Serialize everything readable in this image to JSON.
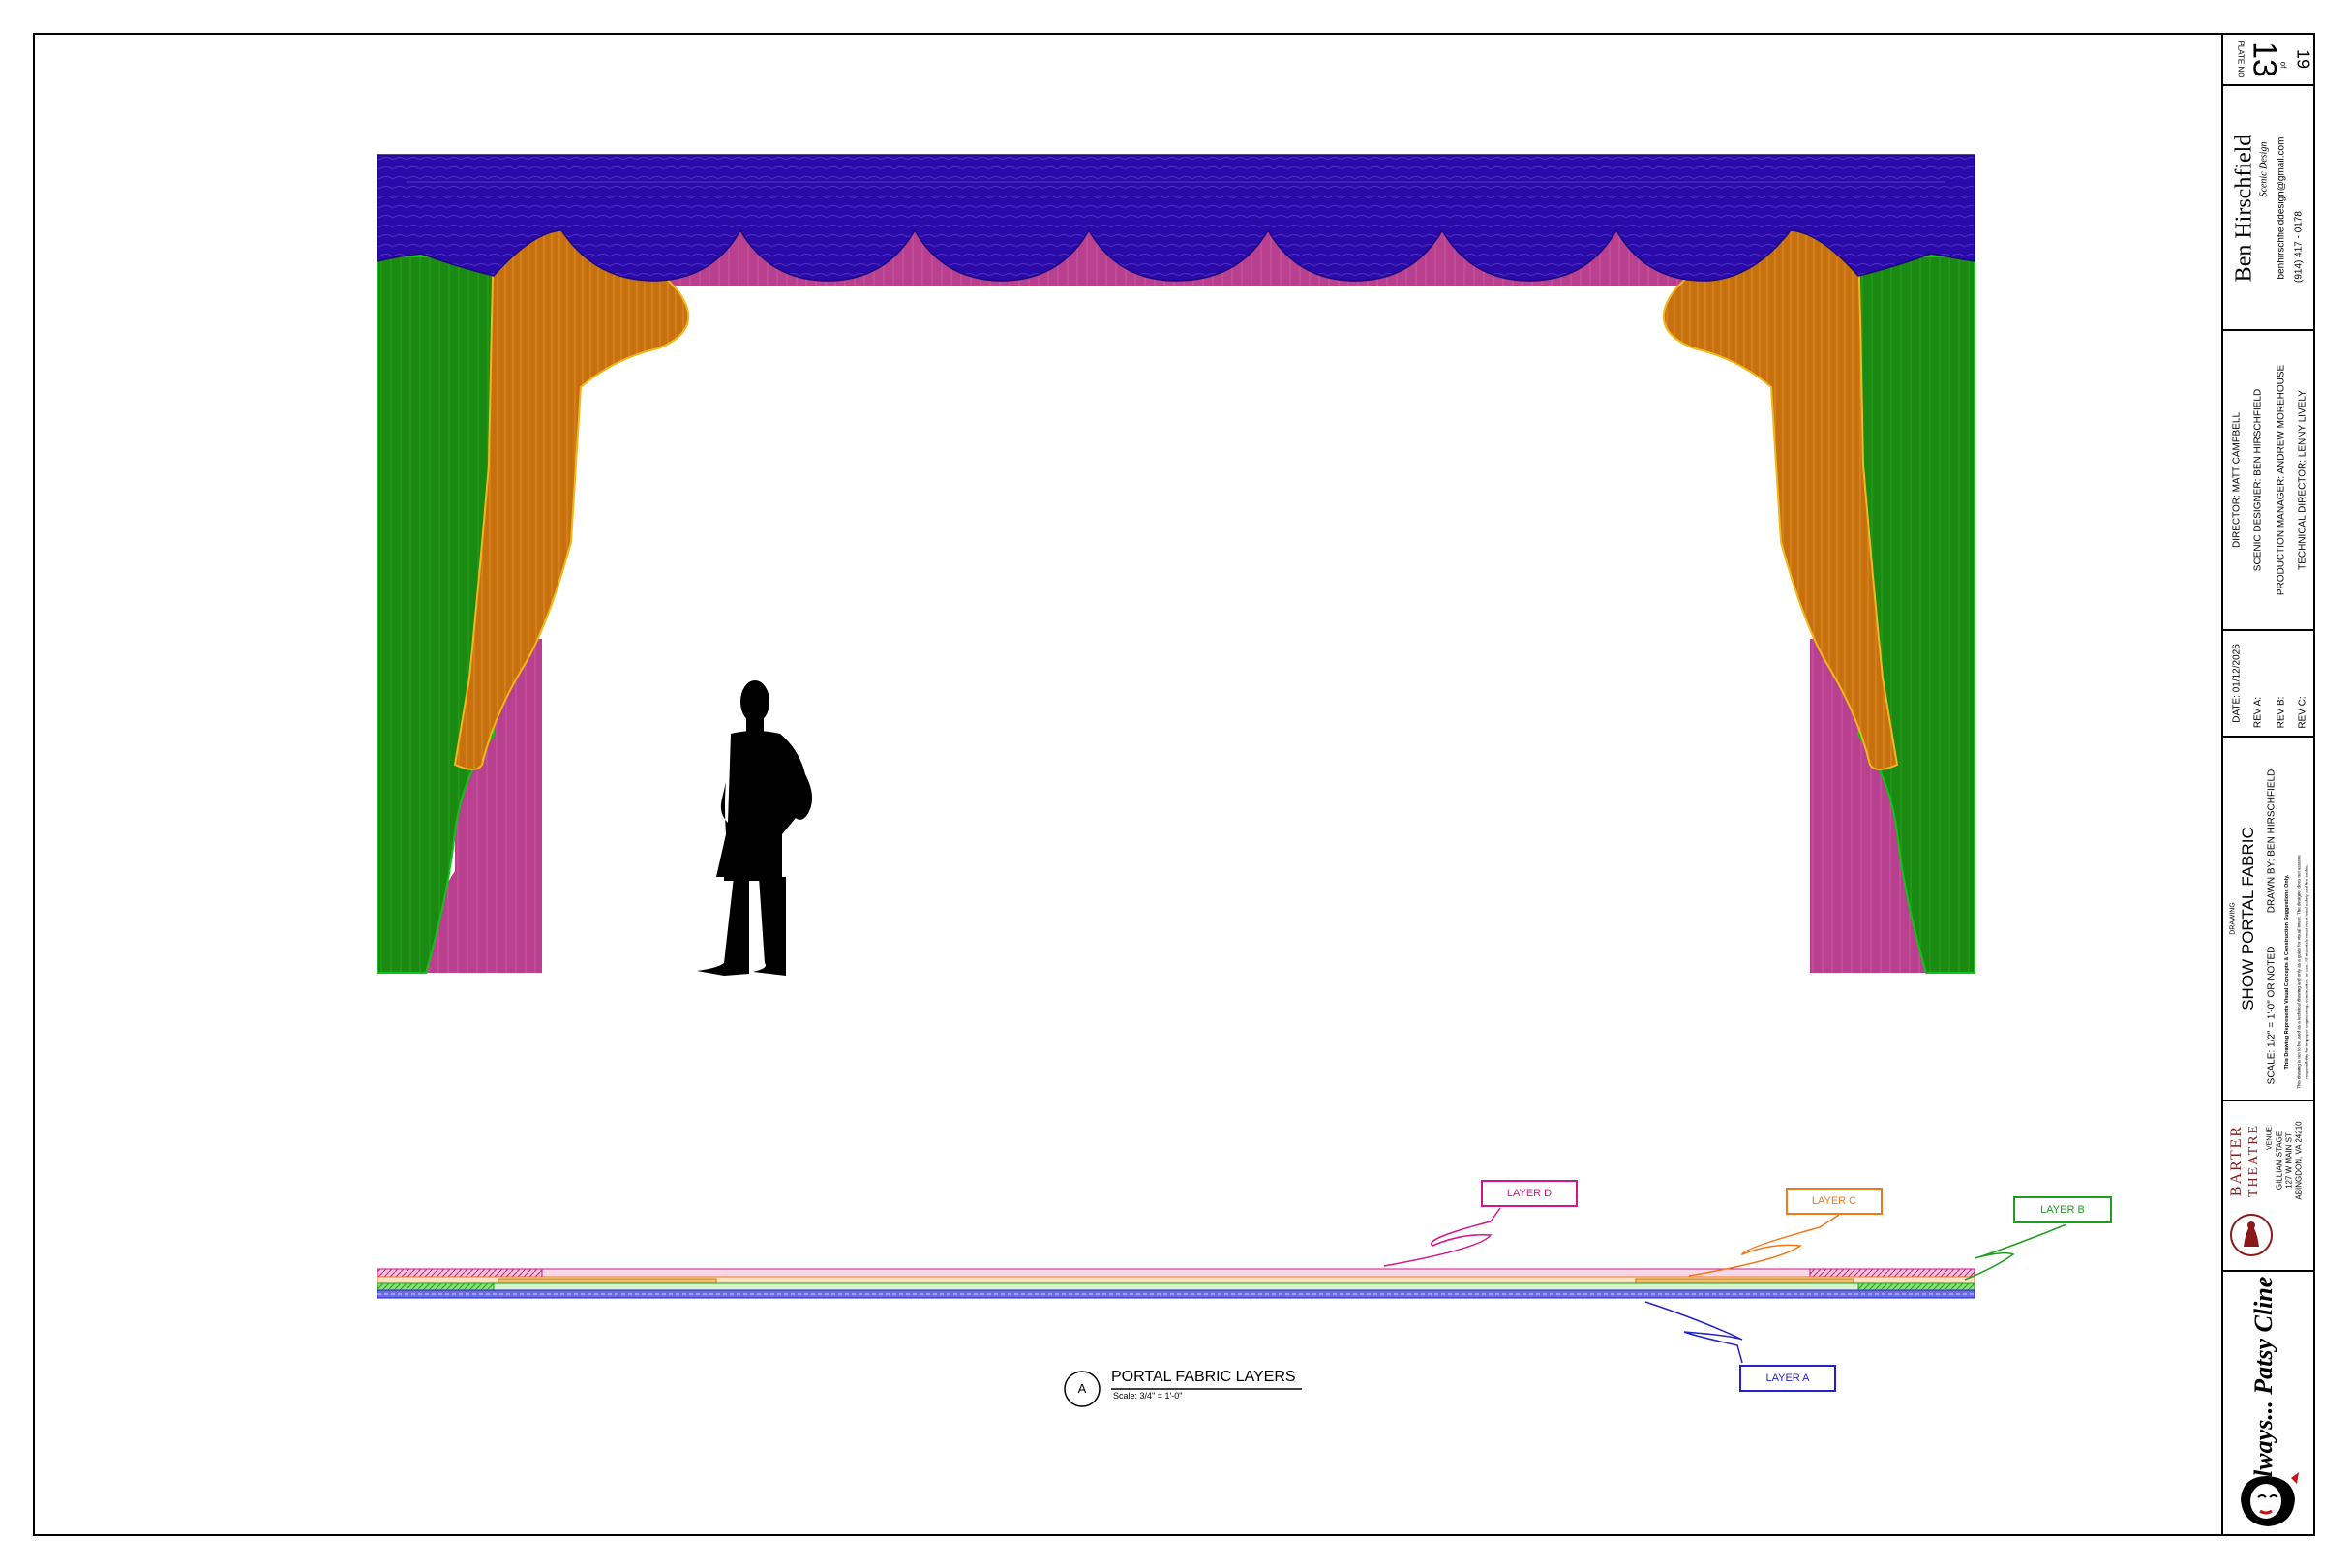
{
  "drawing": {
    "callouts": [
      {
        "label": "LAYER D",
        "color": "#d4148c"
      },
      {
        "label": "LAYER C",
        "color": "#f07818"
      },
      {
        "label": "LAYER B",
        "color": "#1e9e1e"
      },
      {
        "label": "LAYER A",
        "color": "#2222cc"
      }
    ],
    "detail_marker": "A",
    "detail_title": "PORTAL FABRIC LAYERS",
    "detail_scale": "Scale: 3/4\" = 1'-0\""
  },
  "colors": {
    "valance": "#2a0aa8",
    "leg_green": "#1b8a12",
    "swag_orange": "#c8700e",
    "underlay_pink": "#b8408e",
    "figure": "#000000"
  },
  "title_block": {
    "plate_label": "PLATE NO",
    "plate_number": "13",
    "plate_of": "of",
    "plate_total": "19",
    "designer_name": "Ben Hirschfield",
    "designer_sub": "Scenic Design",
    "email": "benhirschfielddesign@gmail.com",
    "phone": "(914) 417 - 0178",
    "credits": [
      "DIRECTOR: MATT CAMPBELL",
      "SCENIC DESIGNER: BEN HIRSCHFIELD",
      "PRODUCTION MANAGER: ANDREW MOREHOUSE",
      "TECHNICAL DIRECTOR: LENNY LIVELY"
    ],
    "date": "DATE: 01/12/2026",
    "rev_a": "REV A:",
    "rev_b": "REV B:",
    "rev_c": "REV C:",
    "drawing_label": "DRAWING",
    "drawing_title": "SHOW PORTAL FABRIC",
    "scale": "SCALE: 1/2\" = 1'-0\" OR NOTED",
    "drawn_by": "DRAWN BY: BEN HIRSCHFIELD",
    "disclaimer_1": "This Drawing Represents Visual Concepts & Construction Suggestions Only.",
    "disclaimer_2": "This drawing is not to be used as a technical drawing and only as a guide for visual intent. The designer does not assume",
    "disclaimer_3": "responsibility for improper engineering, construction, or use. All materials must meet local safety and fire codes.",
    "theatre_top": "BARTER",
    "theatre_bottom": "THEATRE",
    "venue_label": "VENUE:",
    "venue_name": "GILLIAM STAGE",
    "venue_street": "127 W MAIN ST",
    "venue_city": "ABINGDON, VA 24210",
    "show_logo": "Always... Patsy Cline"
  }
}
